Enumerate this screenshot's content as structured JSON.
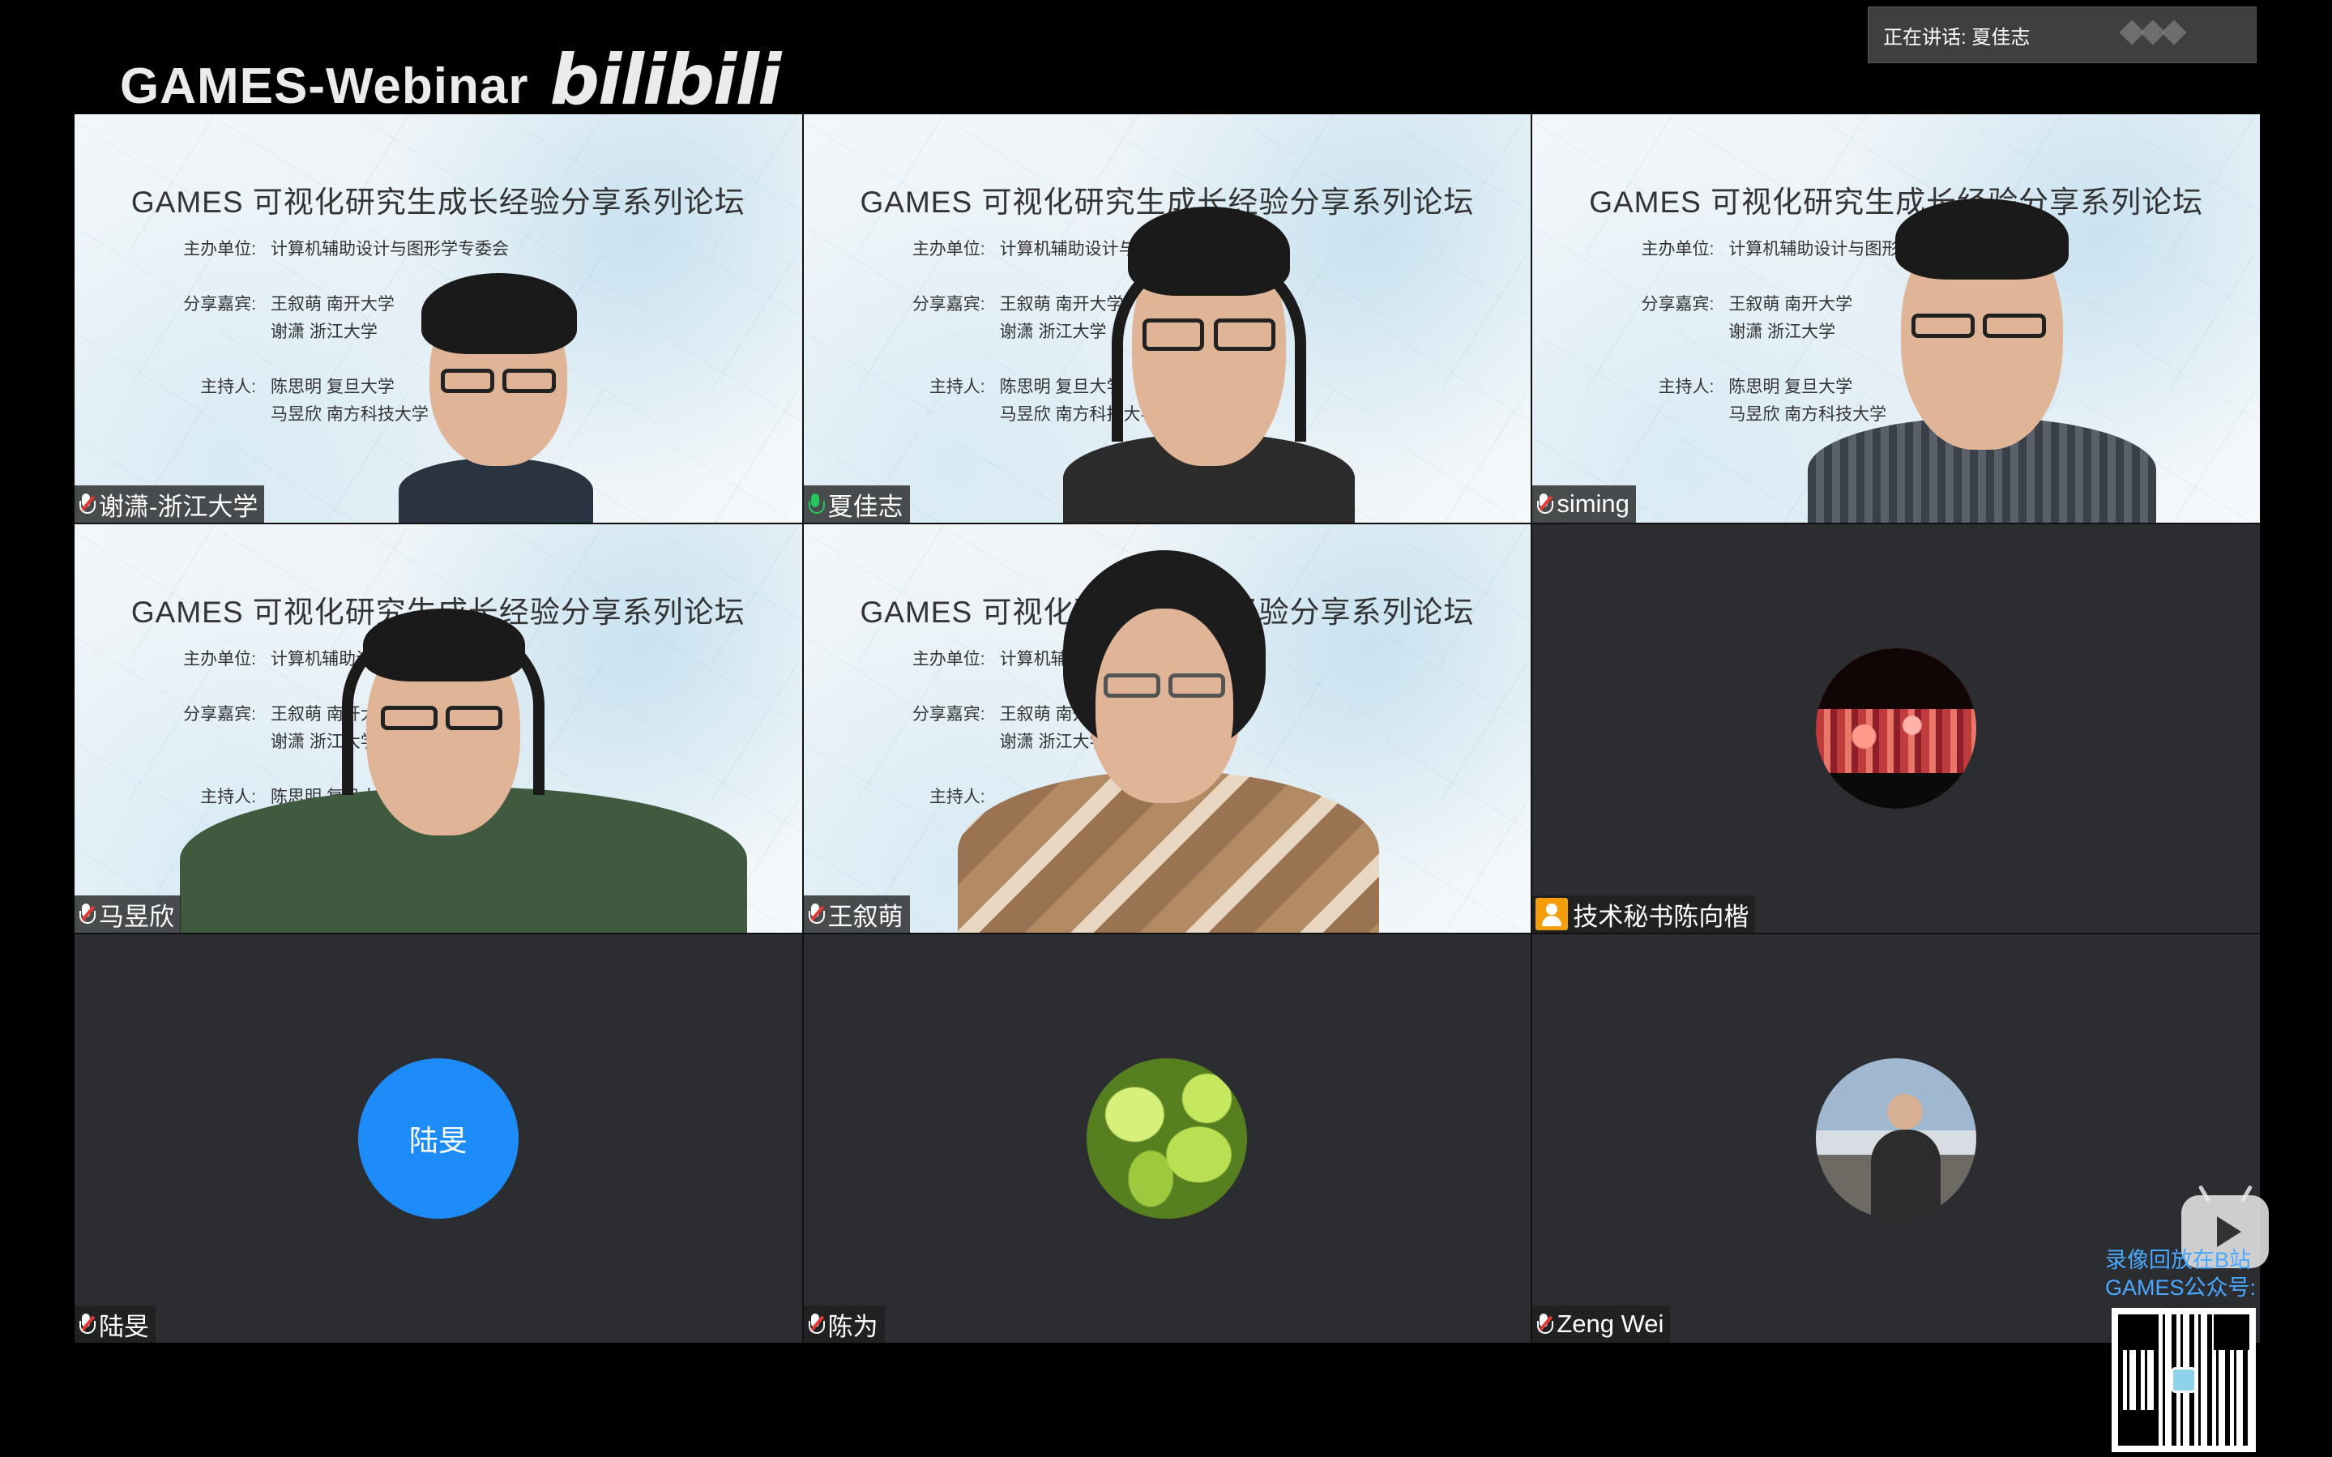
{
  "brand": {
    "text": "GAMES-Webinar",
    "logo": "bilibili"
  },
  "speaking": {
    "label": "正在讲话: 夏佳志"
  },
  "slide": {
    "title": "GAMES 可视化研究生成长经验分享系列论坛",
    "organizer_label": "主办单位:",
    "organizer": "计算机辅助设计与图形学专委会",
    "guests_label": "分享嘉宾:",
    "guest1": "王叙萌 南开大学",
    "guest2": "谢潇 浙江大学",
    "host_label": "主持人:",
    "host1": "陈思明 复旦大学",
    "host2": "马昱欣 南方科技大学"
  },
  "participants": [
    {
      "name": "谢潇-浙江大学",
      "mic": "muted"
    },
    {
      "name": "夏佳志",
      "mic": "live"
    },
    {
      "name": "siming",
      "mic": "muted"
    },
    {
      "name": "马昱欣",
      "mic": "muted"
    },
    {
      "name": "王叙萌",
      "mic": "muted"
    },
    {
      "name": "技术秘书陈向楷",
      "mic": "avatar"
    },
    {
      "name": "陆旻",
      "mic": "muted",
      "avatar_text": "陆旻"
    },
    {
      "name": "陈为",
      "mic": "muted"
    },
    {
      "name": "Zeng Wei",
      "mic": "muted"
    }
  ],
  "replay": {
    "line1": "录像回放在B站",
    "line2": "GAMES公众号:"
  },
  "colors": {
    "active_speaker": "#22c55e",
    "avatar_blue": "#1d8cf8",
    "replay_text": "#4aa8ff"
  }
}
